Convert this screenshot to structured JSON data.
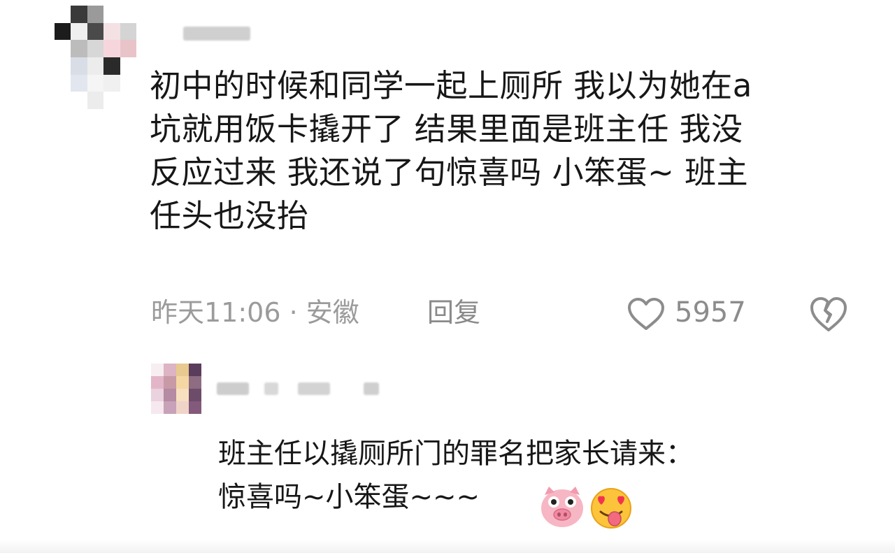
{
  "comment": {
    "text": "初中的时候和同学一起上厕所 我以为她在a\n坑就用饭卡撬开了 结果里面是班主任 我没\n反应过来 我还说了句惊喜吗 小笨蛋~ 班主\n任头也没抬",
    "time_location": "昨天11:06 · 安徽",
    "reply_label": "回复",
    "like_count": "5957",
    "icons": {
      "like": "heart-outline-icon",
      "dislike": "broken-heart-icon"
    }
  },
  "reply": {
    "text": "班主任以撬厕所门的罪名把家长请来：\n惊喜吗~小笨蛋~~~",
    "emojis": [
      "pig-face-emoji",
      "heart-eyes-tongue-emoji"
    ]
  },
  "colors": {
    "text": "#171717",
    "meta_gray": "#9b9b9b",
    "icon_gray": "#8c8c8c",
    "background": "#ffffff"
  }
}
